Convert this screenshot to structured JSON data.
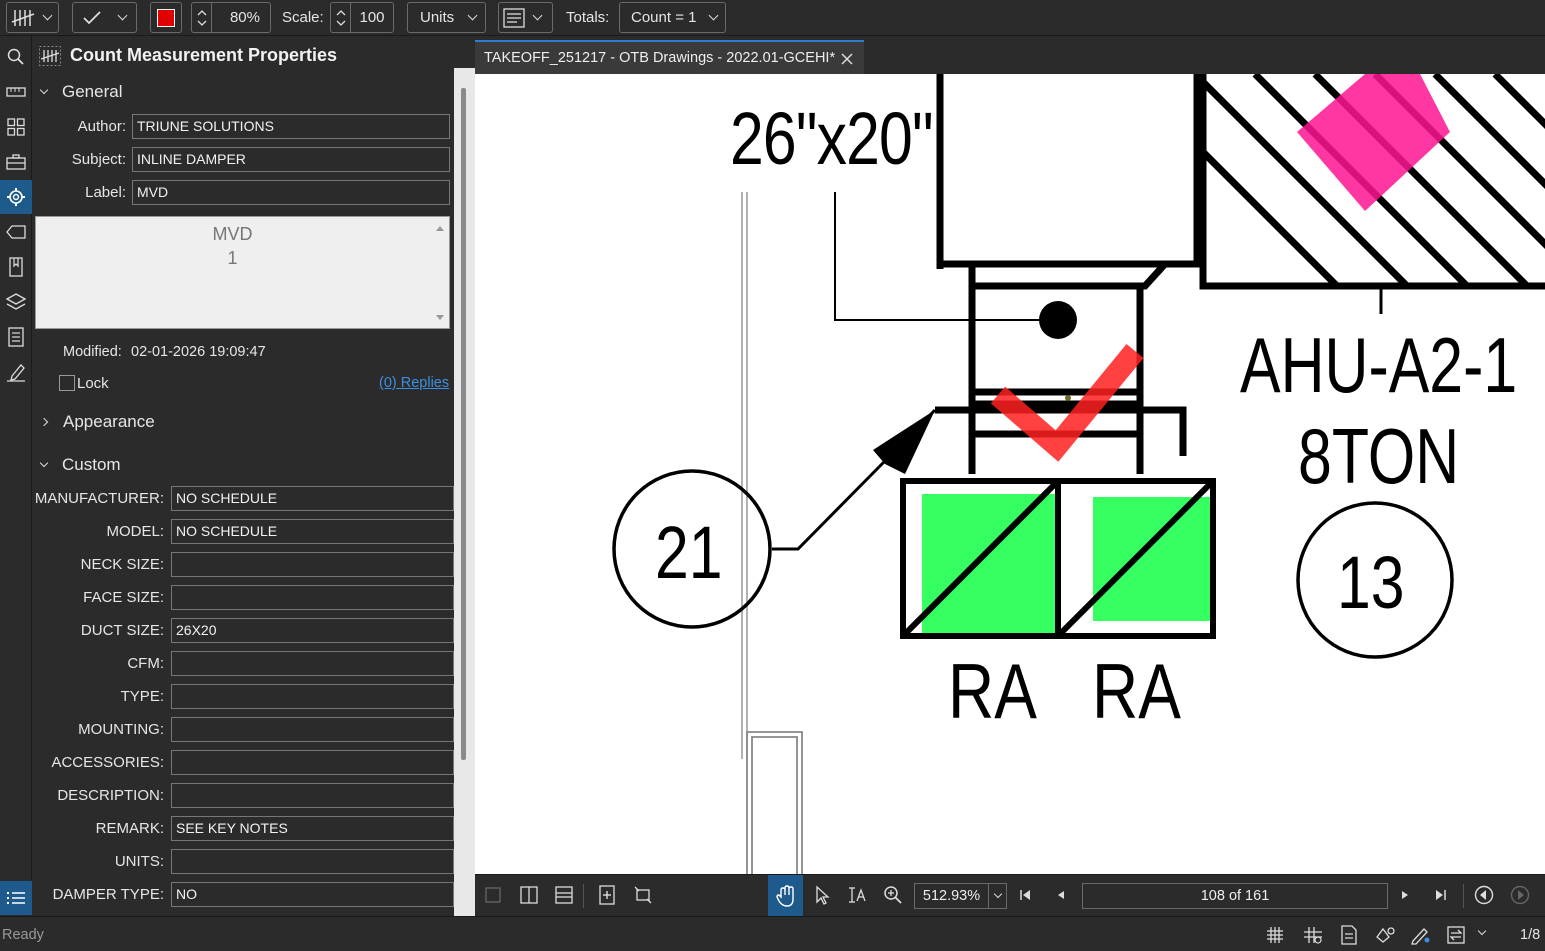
{
  "toolbar": {
    "opacity_value": "80%",
    "scale_label": "Scale:",
    "scale_value": "100",
    "units_label": "Units",
    "totals_label": "Totals:",
    "totals_value": "Count = 1",
    "color_swatch": "#e00000"
  },
  "panel": {
    "title": "Count Measurement Properties",
    "general": {
      "heading": "General",
      "author_label": "Author:",
      "author_value": "TRIUNE SOLUTIONS",
      "subject_label": "Subject:",
      "subject_value": "INLINE DAMPER",
      "label_label": "Label:",
      "label_value": "MVD",
      "preview_line1": "MVD",
      "preview_line2": "1",
      "modified_label": "Modified:",
      "modified_value": "02-01-2026 19:09:47",
      "lock_label": "Lock",
      "replies_link": "(0) Replies"
    },
    "appearance_heading": "Appearance",
    "custom": {
      "heading": "Custom",
      "rows": [
        {
          "label": "MANUFACTURER:",
          "value": "NO SCHEDULE"
        },
        {
          "label": "MODEL:",
          "value": "NO SCHEDULE"
        },
        {
          "label": "NECK SIZE:",
          "value": ""
        },
        {
          "label": "FACE SIZE:",
          "value": ""
        },
        {
          "label": "DUCT SIZE:",
          "value": "26X20"
        },
        {
          "label": "CFM:",
          "value": ""
        },
        {
          "label": "TYPE:",
          "value": ""
        },
        {
          "label": "MOUNTING:",
          "value": ""
        },
        {
          "label": "ACCESSORIES:",
          "value": ""
        },
        {
          "label": "DESCRIPTION:",
          "value": ""
        },
        {
          "label": "REMARK:",
          "value": "SEE KEY NOTES"
        },
        {
          "label": "UNITS:",
          "value": ""
        },
        {
          "label": "DAMPER TYPE:",
          "value": "NO"
        }
      ]
    }
  },
  "document": {
    "tab_title": "TAKEOFF_251217 - OTB Drawings - 2022.01-GCEHI*",
    "drawing": {
      "duct_label": "26\"x20\"",
      "unit_name": "AHU-A2-1",
      "unit_tonnage": "8TON",
      "callout_21": "21",
      "callout_13": "13",
      "ra_left": "RA",
      "ra_right": "RA"
    },
    "colors": {
      "checkmark": "#ff2020",
      "highlight_green": "#2bff5a",
      "highlight_magenta": "#ff1493"
    }
  },
  "navbar": {
    "zoom": "512.93%",
    "page": "108 of 161"
  },
  "status": {
    "text": "Ready",
    "page_short": "1/8"
  }
}
